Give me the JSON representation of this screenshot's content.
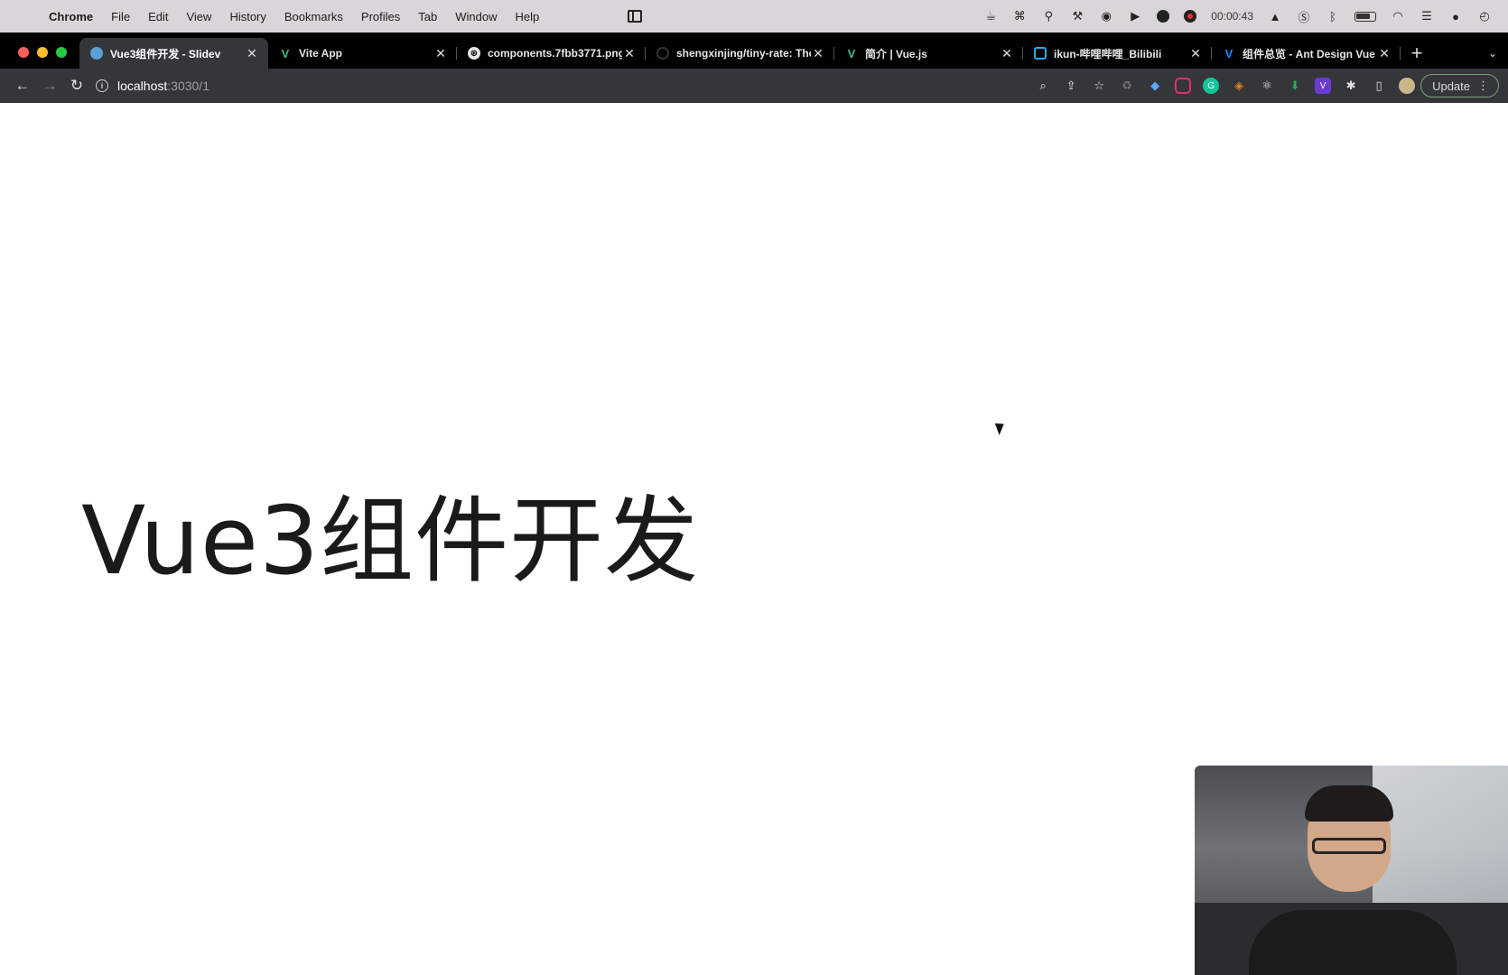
{
  "menubar": {
    "app": "Chrome",
    "menus": [
      "File",
      "Edit",
      "View",
      "History",
      "Bookmarks",
      "Profiles",
      "Tab",
      "Window",
      "Help"
    ],
    "status_icons": [
      "coffee-icon",
      "command-icon",
      "stick-figure-icon",
      "hammer-icon",
      "bear-icon",
      "play-icon",
      "pause-icon",
      "record-icon"
    ],
    "timer": "00:00:43"
  },
  "browser": {
    "tabs": [
      {
        "title": "Vue3组件开发 - Slidev",
        "favicon": "globe-icon",
        "color": "#5aa0d8",
        "active": true
      },
      {
        "title": "Vite App",
        "favicon": "vue-icon",
        "color": "#42b883",
        "active": false
      },
      {
        "title": "components.7fbb3771.png",
        "favicon": "globe-icon",
        "color": "#9aa0a6",
        "active": false
      },
      {
        "title": "shengxinjing/tiny-rate: The",
        "favicon": "github-icon",
        "color": "#333333",
        "active": false
      },
      {
        "title": "简介 | Vue.js",
        "favicon": "vue-icon",
        "color": "#42b883",
        "active": false
      },
      {
        "title": "ikun-哔哩哔哩_Bilibili",
        "favicon": "bilibili-icon",
        "color": "#23ade5",
        "active": false
      },
      {
        "title": "组件总览 - Ant Design Vue",
        "favicon": "ant-icon",
        "color": "#1890ff",
        "active": false
      }
    ],
    "address": {
      "host": "localhost",
      "path": ":3030/1"
    },
    "update_label": "Update"
  },
  "slide": {
    "title": "Vue3组件开发"
  }
}
